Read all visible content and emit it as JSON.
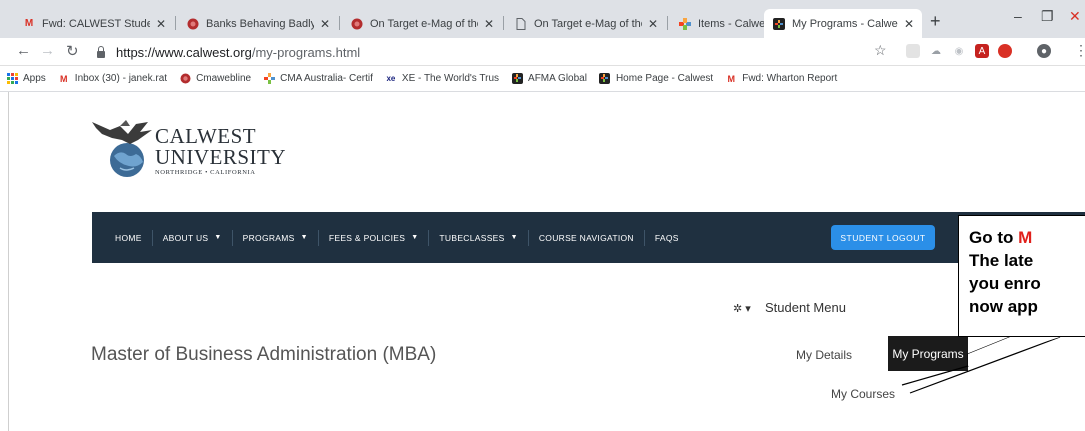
{
  "browser": {
    "tabs": [
      {
        "title": "Fwd: CALWEST Student",
        "icon": "gmail-icon"
      },
      {
        "title": "Banks Behaving Badly –",
        "icon": "site-icon"
      },
      {
        "title": "On Target e-Mag of the",
        "icon": "site-icon"
      },
      {
        "title": "On Target e-Mag of the",
        "icon": "page-icon"
      },
      {
        "title": "Items - Calwest Univers",
        "icon": "joomla-icon"
      },
      {
        "title": "My Programs - Calwest",
        "icon": "joomla-icon"
      }
    ],
    "new_tab": "+",
    "window_controls": {
      "minimize": "–",
      "restore": "❐",
      "close": "✕"
    },
    "address": {
      "host": "https://www.calwest.org",
      "path": "/my-programs.html"
    },
    "bookmarks": [
      {
        "label": "Apps",
        "icon": "apps-grid-icon"
      },
      {
        "label": "Inbox (30) - janek.rat",
        "icon": "gmail-icon"
      },
      {
        "label": "Cmawebline",
        "icon": "site-icon"
      },
      {
        "label": "CMA Australia- Certif",
        "icon": "joomla-icon"
      },
      {
        "label": "XE - The World's Trus",
        "icon": "xe-icon"
      },
      {
        "label": "AFMA Global",
        "icon": "joomla-icon"
      },
      {
        "label": "Home Page - Calwest",
        "icon": "joomla-icon"
      },
      {
        "label": "Fwd: Wharton Report",
        "icon": "gmail-icon"
      }
    ]
  },
  "site": {
    "logo": {
      "line1": "CALWEST",
      "line2": "UNIVERSITY",
      "line3": "NORTHRIDGE • CALIFORNIA"
    },
    "nav": [
      {
        "label": "HOME",
        "dropdown": false
      },
      {
        "label": "ABOUT US",
        "dropdown": true
      },
      {
        "label": "PROGRAMS",
        "dropdown": true
      },
      {
        "label": "FEES & POLICIES",
        "dropdown": true
      },
      {
        "label": "TUBECLASSES",
        "dropdown": true
      },
      {
        "label": "COURSE NAVIGATION",
        "dropdown": false
      },
      {
        "label": "FAQS",
        "dropdown": false
      }
    ],
    "logout_label": "STUDENT LOGOUT",
    "student_menu": {
      "title": "Student Menu",
      "items": {
        "details": "My Details",
        "programs": "My Programs",
        "courses": "My Courses"
      }
    },
    "page_title": "Master of Business Administration (MBA)"
  },
  "callout": {
    "line1_prefix": "Go to ",
    "line1_highlight": "M",
    "line2": "The late",
    "line3": "you enro",
    "line4": "now app",
    "highlight_color": "#e0201b"
  },
  "colors": {
    "nav_bg": "#1f3040",
    "logout_bg": "#2b8fe8",
    "active_menu_bg": "#1b1b1b"
  }
}
